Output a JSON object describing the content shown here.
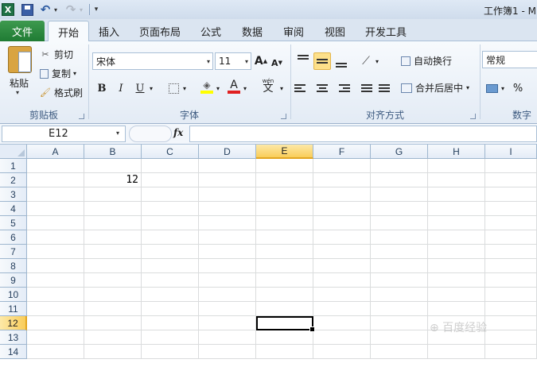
{
  "quick_access": {
    "logo_glyph": "X",
    "undo_glyph": "↶",
    "redo_glyph": "↷",
    "dropdown_glyph": "▾",
    "customize_glyph": "▾"
  },
  "window_title": "工作簿1 - M",
  "tabs": {
    "file": "文件",
    "items": [
      {
        "label": "开始",
        "active": true
      },
      {
        "label": "插入"
      },
      {
        "label": "页面布局"
      },
      {
        "label": "公式"
      },
      {
        "label": "数据"
      },
      {
        "label": "审阅"
      },
      {
        "label": "视图"
      },
      {
        "label": "开发工具"
      }
    ]
  },
  "ribbon": {
    "clipboard": {
      "paste": "粘贴",
      "cut": "剪切",
      "copy": "复制",
      "format_painter": "格式刷",
      "label": "剪贴板"
    },
    "font": {
      "font_name": "宋体",
      "font_size": "11",
      "grow_glyph": "A",
      "shrink_glyph": "A",
      "bold": "B",
      "italic": "I",
      "underline": "U",
      "phonetic": "wén",
      "phonetic_char": "文",
      "font_color_glyph": "A",
      "label": "字体",
      "fill_color": "#ffff00",
      "font_color": "#e02020"
    },
    "alignment": {
      "wrap_text": "自动换行",
      "merge_center": "合并后居中",
      "label": "对齐方式"
    },
    "number": {
      "format": "常规",
      "percent": "%",
      "label": "数字"
    }
  },
  "formula_bar": {
    "name_box": "E12",
    "fx": "fx",
    "formula": ""
  },
  "grid": {
    "columns": [
      "A",
      "B",
      "C",
      "D",
      "E",
      "F",
      "G",
      "H",
      "I"
    ],
    "active_column": "E",
    "rows": [
      "1",
      "2",
      "3",
      "4",
      "5",
      "6",
      "7",
      "8",
      "9",
      "10",
      "11",
      "12",
      "13",
      "14"
    ],
    "active_row": "12",
    "cells": [
      {
        "ref": "B2",
        "value": "12"
      }
    ],
    "selected_cell": "E12"
  },
  "watermark": "⊕ 百度经验"
}
